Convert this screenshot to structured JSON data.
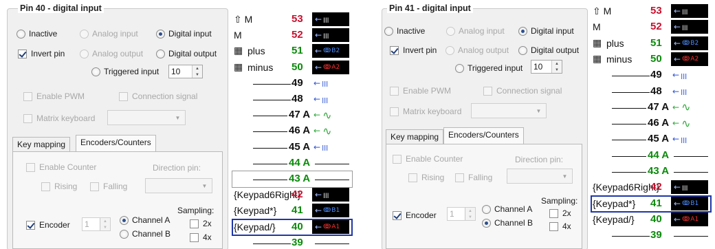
{
  "colors": {
    "red": "#c8102e",
    "green": "#0a8a0a",
    "dark_green": "#1e7a1e",
    "black": "#111111",
    "highlight": "#1f36a8"
  },
  "panels": [
    {
      "title": "Pin 40 - digital input",
      "modes": {
        "inactive": "Inactive",
        "analog_input": "Analog input",
        "digital_input": "Digital input",
        "invert_pin": "Invert pin",
        "analog_output": "Analog output",
        "digital_output": "Digital output",
        "triggered_input": "Triggered input",
        "triggered_value": "10"
      },
      "enable_pwm": "Enable PWM",
      "connection_signal": "Connection signal",
      "matrix_keyboard": "Matrix keyboard",
      "tabs": [
        "Key mapping",
        "Encoders/Counters"
      ],
      "enc": {
        "enable_counter": "Enable Counter",
        "direction_pin": "Direction pin:",
        "rising": "Rising",
        "falling": "Falling",
        "sampling": "Sampling:",
        "encoder": "Encoder",
        "encoder_value": "1",
        "channel_a": "Channel A",
        "channel_b": "Channel B",
        "x2": "2x",
        "x4": "4x"
      },
      "pins": [
        {
          "name": "⇧ M",
          "num": "53",
          "color": "red",
          "icon": "dark",
          "wave": "ꞁꞁꞁ",
          "wc": "",
          "suffix": ""
        },
        {
          "name": "M",
          "num": "52",
          "color": "red",
          "icon": "dark",
          "wave": "ꞁꞁꞁ",
          "wc": "",
          "suffix": ""
        },
        {
          "name": "plus",
          "num": "51",
          "color": "green",
          "icon": "dark",
          "wave": "ↂ",
          "wc": "blue",
          "suffix": "B2",
          "keyboard": true
        },
        {
          "name": "minus",
          "num": "50",
          "color": "green",
          "icon": "dark",
          "wave": "ↂ",
          "wc": "red",
          "suffix": "A2",
          "keyboard": true
        },
        {
          "name": "",
          "num": "49",
          "color": "black",
          "icon": "light",
          "wave": "ꞁꞁꞁ",
          "wc": "lt",
          "suffix": ""
        },
        {
          "name": "",
          "num": "48",
          "color": "black",
          "icon": "light",
          "wave": "ꞁꞁꞁ",
          "wc": "lt",
          "suffix": ""
        },
        {
          "name": "",
          "num": "47 A",
          "color": "black",
          "icon": "sine",
          "suffix": ""
        },
        {
          "name": "",
          "num": "46 A",
          "color": "black",
          "icon": "sine",
          "suffix": ""
        },
        {
          "name": "",
          "num": "45 A",
          "color": "black",
          "icon": "light",
          "wave": "ꞁꞁꞁ",
          "wc": "lt",
          "suffix": ""
        },
        {
          "name": "",
          "num": "44 A",
          "color": "green",
          "icon": "line",
          "suffix": ""
        },
        {
          "name": "",
          "num": "43 A",
          "color": "green",
          "icon": "line",
          "suffix": "",
          "boxed": true
        },
        {
          "name": "{Keypad6Right}",
          "num": "42",
          "color": "red",
          "icon": "dark",
          "wave": "ꞁꞁꞁ",
          "wc": "",
          "suffix": ""
        },
        {
          "name": "{Keypad*}",
          "num": "41",
          "color": "green",
          "icon": "dark",
          "wave": "ↂ",
          "wc": "blue",
          "suffix": "B1"
        },
        {
          "name": "{Keypad/}",
          "num": "40",
          "color": "green",
          "icon": "dark",
          "wave": "ↂ",
          "wc": "red",
          "suffix": "A1",
          "selected": true
        },
        {
          "name": "",
          "num": "39",
          "color": "green",
          "icon": "line",
          "suffix": ""
        }
      ]
    },
    {
      "title": "Pin 41 - digital input",
      "modes": {
        "inactive": "Inactive",
        "analog_input": "Analog input",
        "digital_input": "Digital input",
        "invert_pin": "Invert pin",
        "analog_output": "Analog output",
        "digital_output": "Digital output",
        "triggered_input": "Triggered input",
        "triggered_value": "10"
      },
      "enable_pwm": "Enable PWM",
      "connection_signal": "Connection signal",
      "matrix_keyboard": "Matrix keyboard",
      "tabs": [
        "Key mapping",
        "Encoders/Counters"
      ],
      "enc": {
        "enable_counter": "Enable Counter",
        "direction_pin": "Direction pin:",
        "rising": "Rising",
        "falling": "Falling",
        "sampling": "Sampling:",
        "encoder": "Encoder",
        "encoder_value": "1",
        "channel_a": "Channel A",
        "channel_b": "Channel B",
        "x2": "2x",
        "x4": "4x"
      },
      "pins": [
        {
          "name": "⇧ M",
          "num": "53",
          "color": "red",
          "icon": "dark",
          "wave": "ꞁꞁꞁ",
          "wc": "",
          "suffix": ""
        },
        {
          "name": "M",
          "num": "52",
          "color": "red",
          "icon": "dark",
          "wave": "ꞁꞁꞁ",
          "wc": "",
          "suffix": ""
        },
        {
          "name": "plus",
          "num": "51",
          "color": "green",
          "icon": "dark",
          "wave": "ↂ",
          "wc": "blue",
          "suffix": "B2",
          "keyboard": true
        },
        {
          "name": "minus",
          "num": "50",
          "color": "green",
          "icon": "dark",
          "wave": "ↂ",
          "wc": "red",
          "suffix": "A2",
          "keyboard": true
        },
        {
          "name": "",
          "num": "49",
          "color": "black",
          "icon": "light",
          "wave": "ꞁꞁꞁ",
          "wc": "lt",
          "suffix": ""
        },
        {
          "name": "",
          "num": "48",
          "color": "black",
          "icon": "light",
          "wave": "ꞁꞁꞁ",
          "wc": "lt",
          "suffix": ""
        },
        {
          "name": "",
          "num": "47 A",
          "color": "black",
          "icon": "sine",
          "suffix": ""
        },
        {
          "name": "",
          "num": "46 A",
          "color": "black",
          "icon": "sine",
          "suffix": ""
        },
        {
          "name": "",
          "num": "45 A",
          "color": "black",
          "icon": "light",
          "wave": "ꞁꞁꞁ",
          "wc": "lt",
          "suffix": ""
        },
        {
          "name": "",
          "num": "44 A",
          "color": "green",
          "icon": "line",
          "suffix": ""
        },
        {
          "name": "",
          "num": "43 A",
          "color": "green",
          "icon": "line",
          "suffix": ""
        },
        {
          "name": "{Keypad6Right}",
          "num": "42",
          "color": "red",
          "icon": "dark",
          "wave": "ꞁꞁꞁ",
          "wc": "",
          "suffix": ""
        },
        {
          "name": "{Keypad*}",
          "num": "41",
          "color": "green",
          "icon": "dark",
          "wave": "ↂ",
          "wc": "blue",
          "suffix": "B1",
          "selected": true
        },
        {
          "name": "{Keypad/}",
          "num": "40",
          "color": "green",
          "icon": "dark",
          "wave": "ↂ",
          "wc": "red",
          "suffix": "A1"
        },
        {
          "name": "",
          "num": "39",
          "color": "green",
          "icon": "line",
          "suffix": ""
        }
      ]
    }
  ]
}
